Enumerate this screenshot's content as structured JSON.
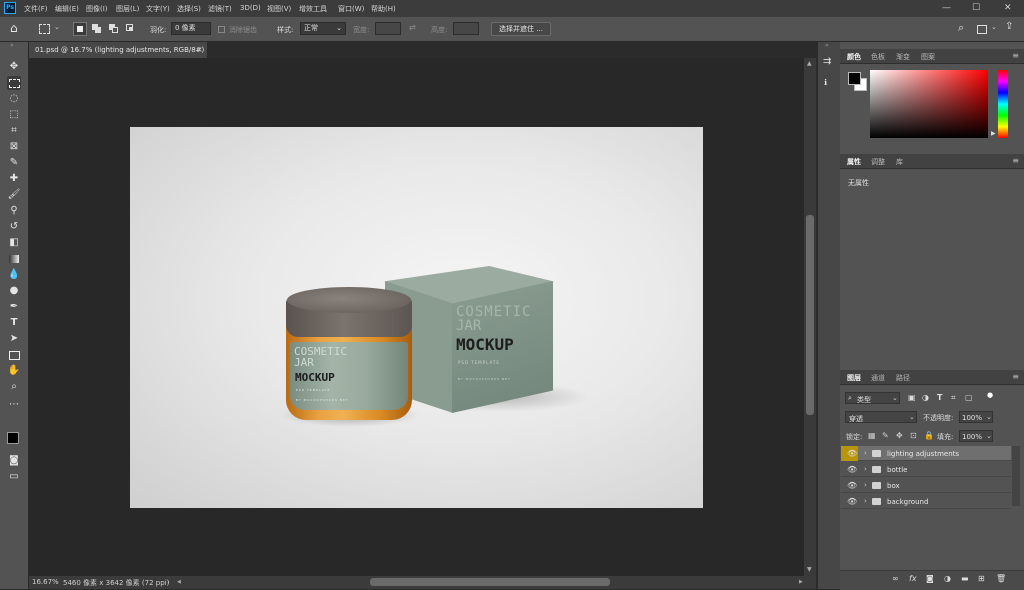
{
  "app": {
    "logo_text": "Ps",
    "menus": [
      "文件(F)",
      "编辑(E)",
      "图像(I)",
      "图层(L)",
      "文字(Y)",
      "选择(S)",
      "滤镜(T)",
      "3D(D)",
      "视图(V)",
      "增效工具",
      "窗口(W)",
      "帮助(H)"
    ],
    "window_controls": [
      "—",
      "☐",
      "✕"
    ]
  },
  "options_bar": {
    "feather_label": "羽化:",
    "feather_value": "0 像素",
    "antialias_label": "消除锯齿",
    "style_label": "样式:",
    "style_value": "正常",
    "width_label": "宽度:",
    "height_label": "高度:",
    "select_mask_button": "选择并遮住 ..."
  },
  "document": {
    "tab_title": "01.psd @ 16.7% (lighting adjustments, RGB/8#)",
    "close_glyph": "×"
  },
  "status_bar": {
    "zoom": "16.67%",
    "doc_info": "5460 像素 x 3642 像素 (72 ppi)",
    "arrow": "›"
  },
  "mockup": {
    "box_line1": "COSMETIC",
    "box_line2": "JAR",
    "box_line3": "MOCKUP",
    "box_line4": "PSD TEMPLATE",
    "box_line5": "BY MOCKUPSHOPS.NET",
    "jar_line1": "COSMETIC",
    "jar_line2": "JAR",
    "jar_line3": "MOCKUP",
    "jar_line4": "PSD TEMPLATE",
    "jar_line5": "BY MOCKUPSHOPS.NET"
  },
  "panels": {
    "color_tabs": [
      "颜色",
      "色板",
      "渐变",
      "图案"
    ],
    "properties_tabs": [
      "属性",
      "调整",
      "库"
    ],
    "properties_empty": "无属性",
    "layers_tabs": [
      "图层",
      "通道",
      "路径"
    ],
    "filter_kind": "类型",
    "blend_mode": "穿透",
    "opacity_label": "不透明度:",
    "opacity_value": "100%",
    "lock_label": "锁定:",
    "fill_label": "填充:",
    "fill_value": "100%",
    "layers": [
      {
        "name": "lighting adjustments",
        "selected": true
      },
      {
        "name": "bottle",
        "selected": false
      },
      {
        "name": "box",
        "selected": false
      },
      {
        "name": "background",
        "selected": false
      }
    ],
    "footer_icons": [
      "link-icon",
      "fx-icon",
      "mask-icon",
      "adjustment-icon",
      "group-icon",
      "new-layer-icon",
      "trash-icon"
    ]
  },
  "colors": {
    "selected_layer": "#b8960a",
    "box_green": "#7f9388",
    "jar_amber": "#d9891e",
    "lid": "#6a625d",
    "accent_blue": "#31a8ff"
  }
}
